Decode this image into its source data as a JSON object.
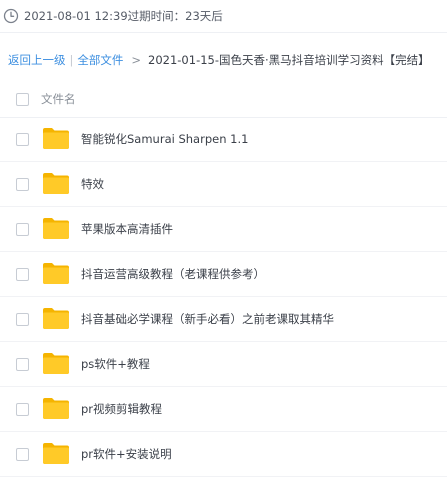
{
  "expiry": {
    "icon": "clock-icon",
    "text": "2021-08-01 12:39过期时间：23天后"
  },
  "breadcrumb": {
    "back_label": "返回上一级",
    "separator": "|",
    "all_files_label": "全部文件",
    "arrow": ">",
    "current_folder": "2021-01-15-国色天香·黑马抖音培训学习资料【完结】"
  },
  "list_header": {
    "name_column": "文件名"
  },
  "files": [
    {
      "name": "智能锐化Samurai Sharpen 1.1",
      "icon": "folder-icon"
    },
    {
      "name": "特效",
      "icon": "folder-icon"
    },
    {
      "name": "苹果版本高清插件",
      "icon": "folder-icon"
    },
    {
      "name": "抖音运营高级教程（老课程供参考）",
      "icon": "folder-icon"
    },
    {
      "name": "抖音基础必学课程（新手必看）之前老课取其精华",
      "icon": "folder-icon"
    },
    {
      "name": "ps软件+教程",
      "icon": "folder-icon"
    },
    {
      "name": "pr视频剪辑教程",
      "icon": "folder-icon"
    },
    {
      "name": "pr软件+安装说明",
      "icon": "folder-icon"
    }
  ],
  "colors": {
    "folder": "#FFCA28",
    "folder_dark": "#F5B400",
    "link": "#3D8FE0",
    "text": "#3A3F48",
    "muted": "#8A9099"
  }
}
